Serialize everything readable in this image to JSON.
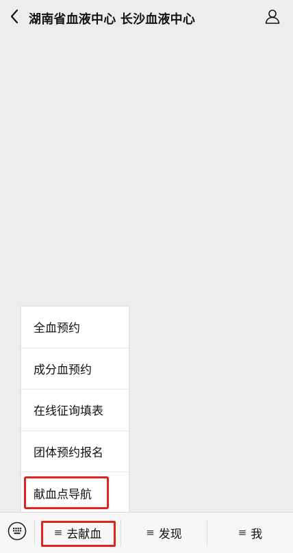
{
  "header": {
    "title": "湖南省血液中心 长沙血液中心",
    "back_icon": "chevron-left-icon",
    "profile_icon": "person-icon"
  },
  "menu": {
    "items": [
      {
        "label": "全血预约"
      },
      {
        "label": "成分血预约"
      },
      {
        "label": "在线征询填表"
      },
      {
        "label": "团体预约报名"
      },
      {
        "label": "献血点导航"
      }
    ]
  },
  "bottom_bar": {
    "keyboard_icon": "keyboard-icon",
    "tabs": [
      {
        "icon": "≡",
        "label": "去献血"
      },
      {
        "icon": "≡",
        "label": "发现"
      },
      {
        "icon": "≡",
        "label": "我"
      }
    ]
  },
  "colors": {
    "background": "#ededed",
    "highlight": "#e0231c"
  }
}
